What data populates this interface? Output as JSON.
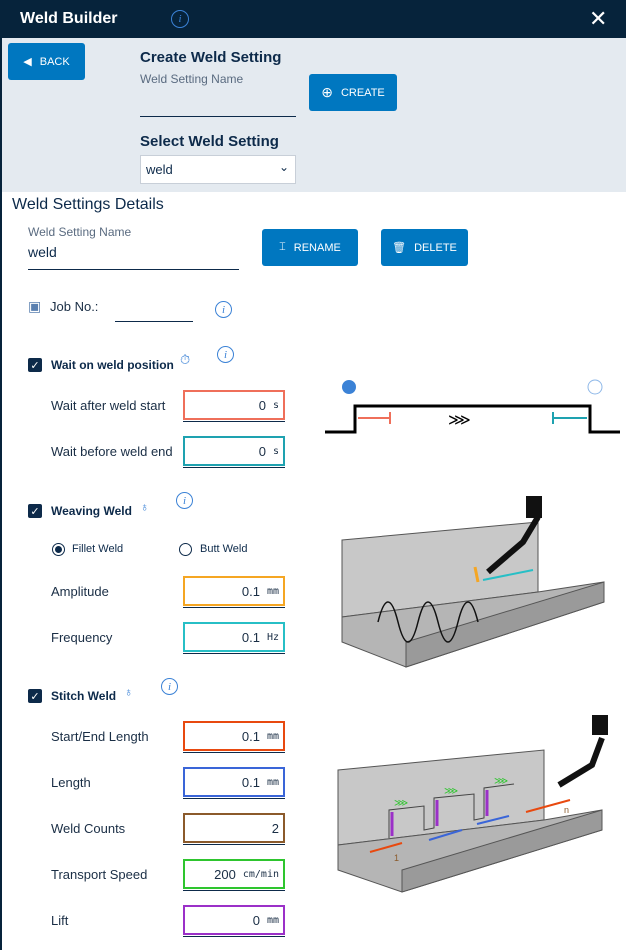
{
  "header": {
    "title": "Weld Builder",
    "close_icon": "close-icon",
    "info_icon": "info-icon"
  },
  "top": {
    "back_label": "BACK",
    "create_title": "Create Weld Setting",
    "name_label": "Weld Setting Name",
    "name_value": "",
    "create_label": "CREATE",
    "select_title": "Select Weld Setting",
    "select_value": "weld"
  },
  "details": {
    "title": "Weld Settings Details",
    "name_label": "Weld Setting Name",
    "name_value": "weld",
    "rename_label": "RENAME",
    "delete_label": "DELETE",
    "job_label": "Job No.:",
    "job_value": ""
  },
  "wait": {
    "checked": true,
    "label": "Wait on weld position",
    "after_label": "Wait after weld start",
    "after_value": "0",
    "after_unit": "s",
    "before_label": "Wait before weld end",
    "before_value": "0",
    "before_unit": "s"
  },
  "weaving": {
    "checked": true,
    "label": "Weaving Weld",
    "fillet_label": "Fillet Weld",
    "butt_label": "Butt Weld",
    "selected": "Fillet Weld",
    "amplitude_label": "Amplitude",
    "amplitude_value": "0.1",
    "amplitude_unit": "mm",
    "frequency_label": "Frequency",
    "frequency_value": "0.1",
    "frequency_unit": "Hz"
  },
  "stitch": {
    "checked": true,
    "label": "Stitch Weld",
    "start_end_label": "Start/End Length",
    "start_end_value": "0.1",
    "start_end_unit": "mm",
    "length_label": "Length",
    "length_value": "0.1",
    "length_unit": "mm",
    "counts_label": "Weld Counts",
    "counts_value": "2",
    "speed_label": "Transport Speed",
    "speed_value": "200",
    "speed_unit": "cm/min",
    "lift_label": "Lift",
    "lift_value": "0",
    "lift_unit": "mm",
    "diagram_label_start": "1",
    "diagram_label_end": "n"
  },
  "colors": {
    "header": "#06233b",
    "accent": "#0077c0",
    "wait_after": "#ef6f5a",
    "wait_before": "#1ea2b0",
    "amplitude": "#f5a623",
    "frequency": "#27bfc6",
    "start_end": "#e8490f",
    "length": "#3a65d8",
    "counts": "#8b5a2b",
    "speed": "#2ec52e",
    "lift": "#9b30c8"
  }
}
